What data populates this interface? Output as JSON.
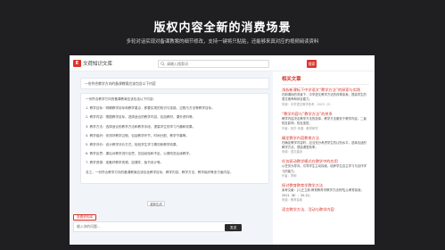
{
  "hero": {
    "title": "版权内容全新的消费场景",
    "subtitle": "多轮对话实现对备课教案的细节修改，支持一键将只贴贴，还能够来真对应的视频阅读资料"
  },
  "app": {
    "logo_mark": "E",
    "logo_text": "文荷知识文库",
    "search_placeholder": "请输入搜索词",
    "search_button": "搜索"
  },
  "chat": {
    "user_prompt": "一份符合教学方向的备课教案应该包含以下内容",
    "ai_lines": [
      "一份符合教学方向的备课教案应该包含以下内容：",
      "1. 教学目标：明确教学目标和教学重点，即要实现的知识与技能、过程与方法等教学目标。",
      "2. 教学内容：根据教学目标，选择适合的教学内容，包括教材、课外资料等。",
      "3. 教学方法：选择适合的教学方法和教学手段，提高学生的学习兴趣和效果。",
      "4. 教学组织：安排好教学过程，包括教学环节、时间分配、教学节奏等。",
      "5. 教学评价：设计教学评价方式，检验学生学习情况和教学效果。",
      "6. 教学反思：课后对教学进行反思，总结经验和不足，以便改进后续教学。",
      "7. 教学资源：准备好教学资源，如课件、板书设计等。",
      "总之，一份符合教学方向的备课教案应该包含教学目标、教学内容、教学方法、教学组织等多方面内容。"
    ],
    "chip_label": "重新生成",
    "tag_label": "查看资料库",
    "input_placeholder": "输入你的问题...",
    "send_label": "发送"
  },
  "side": {
    "heading": "相关文章",
    "cards": [
      {
        "title": "浅析新课标下中学语文“教学方法”的探索与实践",
        "body": "在新课标的背景下，中学语文教学方法的改革探索，提高学生的语文素养和综合能力。",
        "meta": "来源：中学语文教学参考，2023（5）"
      },
      {
        "title": "“教学内容与“教学方法”的关系",
        "body": "教学内容决定教学方法的选择，教学方法服务于教学内容，二者相互影响，相互促进。",
        "meta": "作者：张华 来源：教育研究"
      },
      {
        "title": "确定教学内容教育方法",
        "body": "在确定教学内容时，应当充分考虑学生的认知水平，选择合适的教学方法，提高课堂效率。",
        "meta": "来源：语文建设"
      },
      {
        "title": "任务驱动教学模式在教学中的应用",
        "body": "以任务为导向，引导学生主动探索，培养学生自主学习与合作学习的能力。",
        "meta": "作者：李明"
      },
      {
        "title": "探讨教育教育学教学方法",
        "body": "参考文献：[1]王立新.教育教育学教学方法研究[J].教育探索，2021（6）：20-22。",
        "meta": "来源：教育探索"
      },
      {
        "title": "语言教学方法、活动与教学内容",
        "body": "",
        "meta": ""
      }
    ]
  }
}
